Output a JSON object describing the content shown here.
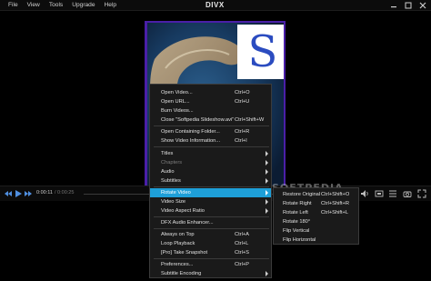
{
  "window": {
    "logo": "DIVX",
    "menu": [
      "File",
      "View",
      "Tools",
      "Upgrade",
      "Help"
    ]
  },
  "player": {
    "time_current": "0:00:11",
    "time_total": "/ 0:00:25"
  },
  "context_menu": {
    "items": [
      {
        "label": "Open Video...",
        "shortcut": "Ctrl+O"
      },
      {
        "label": "Open URL...",
        "shortcut": "Ctrl+U"
      },
      {
        "label": "Burn Videos...",
        "shortcut": ""
      },
      {
        "label": "Close \"Softpedia Slideshow.avi\"",
        "shortcut": "Ctrl+Shift+W"
      },
      {
        "label": "Open Containing Folder...",
        "shortcut": "Ctrl+R"
      },
      {
        "label": "Show Video Information...",
        "shortcut": "Ctrl+I"
      },
      {
        "label": "Titles",
        "shortcut": ""
      },
      {
        "label": "Chapters",
        "shortcut": ""
      },
      {
        "label": "Audio",
        "shortcut": ""
      },
      {
        "label": "Subtitles",
        "shortcut": ""
      },
      {
        "label": "Rotate Video",
        "shortcut": ""
      },
      {
        "label": "Video Size",
        "shortcut": ""
      },
      {
        "label": "Video Aspect Ratio",
        "shortcut": ""
      },
      {
        "label": "DFX Audio Enhancer...",
        "shortcut": ""
      },
      {
        "label": "Always on Top",
        "shortcut": "Ctrl+A"
      },
      {
        "label": "Loop Playback",
        "shortcut": "Ctrl+L"
      },
      {
        "label": "[Pro] Take Snapshot",
        "shortcut": "Ctrl+S"
      },
      {
        "label": "Preferences...",
        "shortcut": "Ctrl+P"
      },
      {
        "label": "Subtitle Encoding",
        "shortcut": ""
      }
    ]
  },
  "rotate_submenu": {
    "items": [
      {
        "label": "Restore Original",
        "shortcut": "Ctrl+Shift+O"
      },
      {
        "label": "Rotate Right",
        "shortcut": "Ctrl+Shift+R"
      },
      {
        "label": "Rotate Left",
        "shortcut": "Ctrl+Shift+L"
      },
      {
        "label": "Rotate 180°",
        "shortcut": ""
      },
      {
        "label": "Flip Vertical",
        "shortcut": ""
      },
      {
        "label": "Flip Horizontal",
        "shortcut": ""
      }
    ]
  },
  "watermark": "SOFTPEDIA",
  "colors": {
    "accent_highlight": "#1e9fd8",
    "frame_border": "#4a1fa8",
    "menu_bg": "#1a1a1a"
  },
  "icons": [
    "minimize-icon",
    "maximize-icon",
    "close-icon",
    "rewind-icon",
    "play-icon",
    "fast-forward-icon",
    "volume-icon",
    "aspect-ratio-icon",
    "playlist-icon",
    "snapshot-icon",
    "fullscreen-icon"
  ]
}
